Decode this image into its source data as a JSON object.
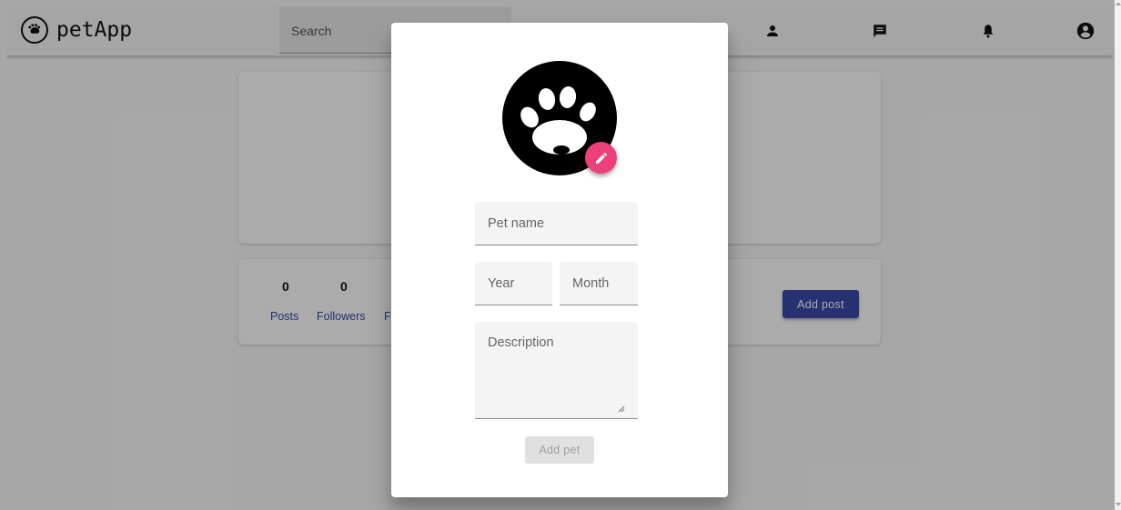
{
  "appbar": {
    "logo_text": "petApp",
    "search_placeholder": "Search",
    "icons": [
      "person-icon",
      "chat-icon",
      "bell-icon",
      "account-circle-icon"
    ]
  },
  "profile": {
    "stats": [
      {
        "value": "0",
        "label": "Posts"
      },
      {
        "value": "0",
        "label": "Followers"
      },
      {
        "value": "",
        "label": "F"
      }
    ],
    "add_post_label": "Add post"
  },
  "dialog": {
    "avatar_icon": "paw-icon",
    "edit_icon": "pencil-icon",
    "pet_name_placeholder": "Pet name",
    "year_placeholder": "Year",
    "month_placeholder": "Month",
    "description_placeholder": "Description",
    "add_pet_label": "Add pet",
    "colors": {
      "accent": "#ec407a",
      "primary": "#3949ab"
    }
  }
}
